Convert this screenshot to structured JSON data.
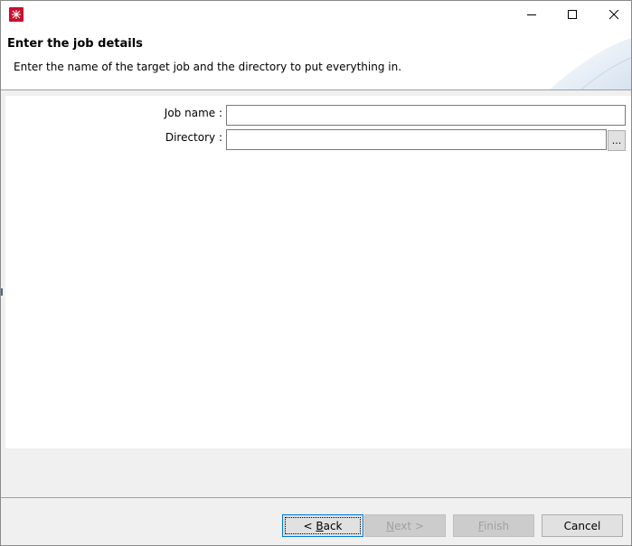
{
  "window": {
    "icon": "eclipse-app-icon",
    "controls": {
      "minimize": "minimize-icon",
      "maximize": "maximize-icon",
      "close": "close-icon"
    }
  },
  "header": {
    "title": "Enter the job details",
    "description": "Enter the name of the target job and the directory to put everything in."
  },
  "form": {
    "job_name_label": "Job name :",
    "job_name_value": "",
    "directory_label": "Directory :",
    "directory_value": "",
    "browse_label": "..."
  },
  "buttons": {
    "back_prefix": "< ",
    "back_mnemonic": "B",
    "back_rest": "ack",
    "next_mnemonic": "N",
    "next_rest": "ext >",
    "finish_mnemonic": "F",
    "finish_rest": "inish",
    "cancel": "Cancel"
  },
  "colors": {
    "accent": "#0078d7",
    "app_icon": "#c8102e",
    "disabled_text": "#a0a0a0"
  }
}
